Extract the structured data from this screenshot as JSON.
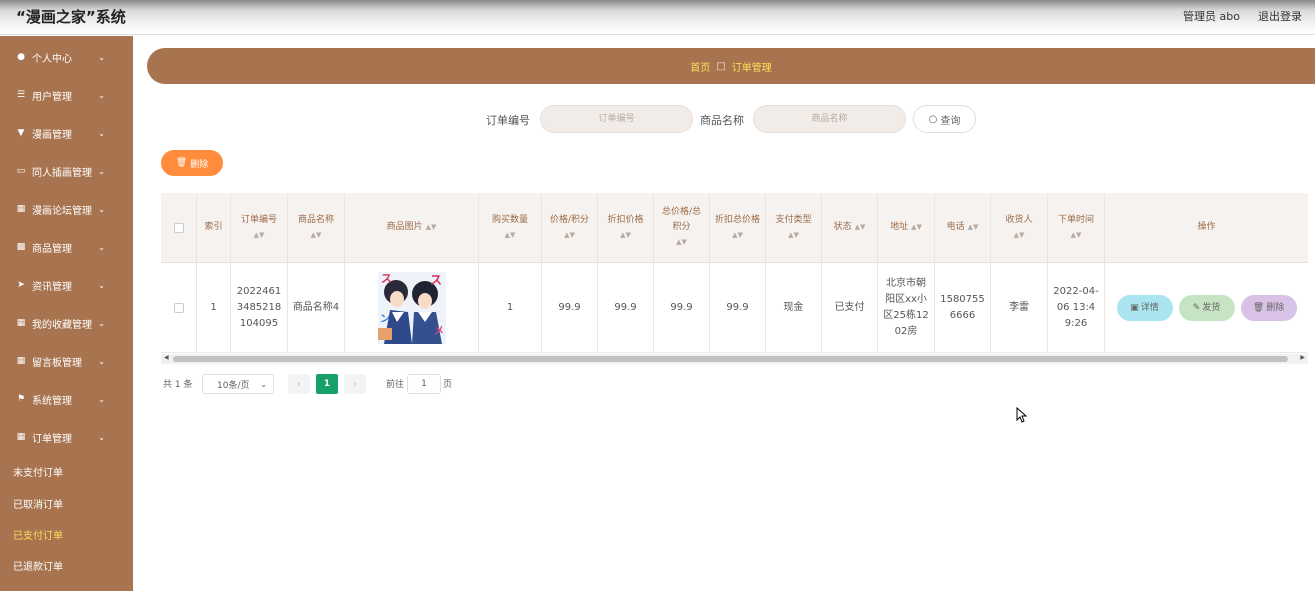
{
  "header": {
    "title": "“漫画之家”系统",
    "admin": "管理员 abo",
    "logout": "退出登录"
  },
  "sidebar": {
    "items": [
      {
        "label": "个人中心",
        "icon": "user-icon"
      },
      {
        "label": "用户管理",
        "icon": "list-icon"
      },
      {
        "label": "漫画管理",
        "icon": "filter-icon"
      },
      {
        "label": "同人插画管理",
        "icon": "tray-icon"
      },
      {
        "label": "漫画论坛管理",
        "icon": "grid-icon"
      },
      {
        "label": "商品管理",
        "icon": "apps-icon"
      },
      {
        "label": "资讯管理",
        "icon": "send-icon"
      },
      {
        "label": "我的收藏管理",
        "icon": "grid-icon"
      },
      {
        "label": "留言板管理",
        "icon": "grid-icon"
      },
      {
        "label": "系统管理",
        "icon": "flag-icon"
      },
      {
        "label": "订单管理",
        "icon": "grid-icon"
      }
    ],
    "subitems": [
      {
        "label": "未支付订单",
        "active": false
      },
      {
        "label": "已取消订单",
        "active": false
      },
      {
        "label": "已支付订单",
        "active": true
      },
      {
        "label": "已退款订单",
        "active": false
      }
    ]
  },
  "breadcrumb": {
    "home": "首页",
    "current": "订单管理"
  },
  "search": {
    "order_label": "订单编号",
    "order_placeholder": "订单编号",
    "product_label": "商品名称",
    "product_placeholder": "商品名称",
    "button": "查询"
  },
  "toolbar": {
    "delete_label": "删除"
  },
  "table": {
    "headers": {
      "index": "索引",
      "order_no": "订单编号",
      "product_name": "商品名称",
      "product_image": "商品图片",
      "quantity": "购买数量",
      "price": "价格/积分",
      "discount_price": "折扣价格",
      "total": "总价格/总积分",
      "discount_total": "折扣总价格",
      "pay_type": "支付类型",
      "status": "状态",
      "address": "地址",
      "phone": "电话",
      "receiver": "收货人",
      "order_time": "下单时间",
      "actions": "操作"
    },
    "rows": [
      {
        "index": "1",
        "order_no": "20224613485218104095",
        "product_name": "商品名称4",
        "quantity": "1",
        "price": "99.9",
        "discount_price": "99.9",
        "total": "99.9",
        "discount_total": "99.9",
        "pay_type": "现金",
        "status": "已支付",
        "address": "北京市朝阳区xx小区25栋1202房",
        "phone": "15807556666",
        "receiver": "李雷",
        "order_time": "2022-04-06 13:49:26",
        "detail": "详情",
        "ship": "发货",
        "delete": "删除"
      }
    ]
  },
  "pagination": {
    "total": "共 1 条",
    "page_size": "10条/页",
    "current": "1",
    "goto_label": "前往",
    "goto_value": "1",
    "goto_unit": "页"
  }
}
